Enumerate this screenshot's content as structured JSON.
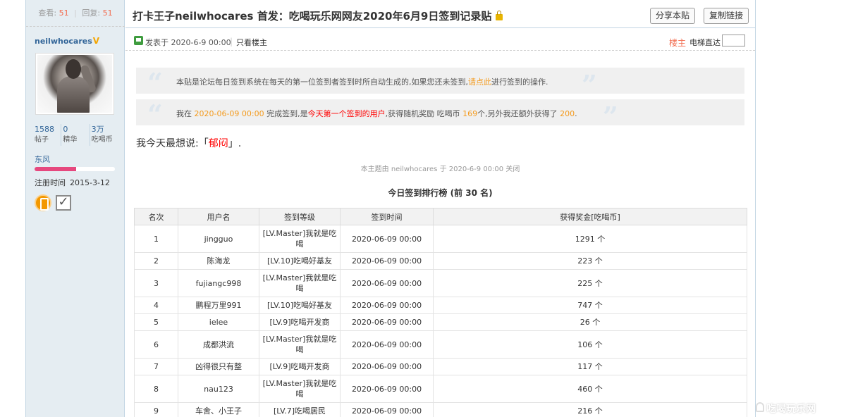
{
  "sidebar": {
    "views_label": "查看:",
    "views": "51",
    "replies_label": "回复:",
    "replies": "51",
    "username": "neilwhocares",
    "vip_mark": "V",
    "stats": [
      {
        "value": "1588",
        "label": "帖子"
      },
      {
        "value": "0",
        "label": "精华"
      },
      {
        "value": "3万",
        "label": "吃喝币"
      }
    ],
    "group": "东风",
    "level_progress": 0.52,
    "reg_label": "注册时间",
    "reg_date": "2015-3-12",
    "level_color": "#e6487e"
  },
  "header": {
    "title": "打卡王子neilwhocares 首发：吃喝玩乐网网友2020年6月9日签到记录贴",
    "share_label": "分享本贴",
    "copy_label": "复制链接"
  },
  "meta": {
    "posted": "发表于 2020-6-9 00:00",
    "only_op": "只看楼主",
    "floor": "楼主",
    "elevator": "电梯直达"
  },
  "quote1": {
    "a": "本贴是论坛每日签到系统在每天的第一位签到者签到时所自动生成的,如果您还未签到,",
    "link": "请点此",
    "b": "进行签到的操作."
  },
  "quote2": {
    "a": "我在 ",
    "time": "2020-06-09 00:00",
    "b": " 完成签到,是",
    "first": "今天第一个签到的用户",
    "c": ",获得随机奖励 吃喝币 ",
    "reward": "169",
    "d": "个,另外我还额外获得了 ",
    "extra": "200",
    "e": "."
  },
  "mood": {
    "prefix": "我今天最想说:「",
    "word": "郁闷",
    "suffix": "」."
  },
  "closed_note": "本主题由 neilwhocares 于 2020-6-9 00:00 关闭",
  "rank_title": "今日签到排行榜 (前 30 名)",
  "table": {
    "headers": [
      "名次",
      "用户名",
      "签到等级",
      "签到时间",
      "获得奖金[吃喝币]"
    ],
    "rows": [
      {
        "rank": "1",
        "user": "jingguo",
        "level": "[LV.Master]我就是吃喝",
        "time": "2020-06-09 00:00",
        "prize": "1291 个"
      },
      {
        "rank": "2",
        "user": "陈海龙",
        "level": "[LV.10]吃喝好基友",
        "time": "2020-06-09 00:00",
        "prize": "223 个"
      },
      {
        "rank": "3",
        "user": "fujiangc998",
        "level": "[LV.Master]我就是吃喝",
        "time": "2020-06-09 00:00",
        "prize": "225 个"
      },
      {
        "rank": "4",
        "user": "鹏程万里991",
        "level": "[LV.10]吃喝好基友",
        "time": "2020-06-09 00:00",
        "prize": "747 个"
      },
      {
        "rank": "5",
        "user": "ielee",
        "level": "[LV.9]吃喝开发商",
        "time": "2020-06-09 00:00",
        "prize": "26 个"
      },
      {
        "rank": "6",
        "user": "成都洪流",
        "level": "[LV.Master]我就是吃喝",
        "time": "2020-06-09 00:00",
        "prize": "106 个"
      },
      {
        "rank": "7",
        "user": "凶得很只有整",
        "level": "[LV.9]吃喝开发商",
        "time": "2020-06-09 00:00",
        "prize": "117 个"
      },
      {
        "rank": "8",
        "user": "nau123",
        "level": "[LV.Master]我就是吃喝",
        "time": "2020-06-09 00:00",
        "prize": "460 个"
      },
      {
        "rank": "9",
        "user": "车舍、小王子",
        "level": "[LV.7]吃喝居民",
        "time": "2020-06-09 00:00",
        "prize": "216 个"
      }
    ]
  },
  "watermark": "吃喝玩乐网"
}
